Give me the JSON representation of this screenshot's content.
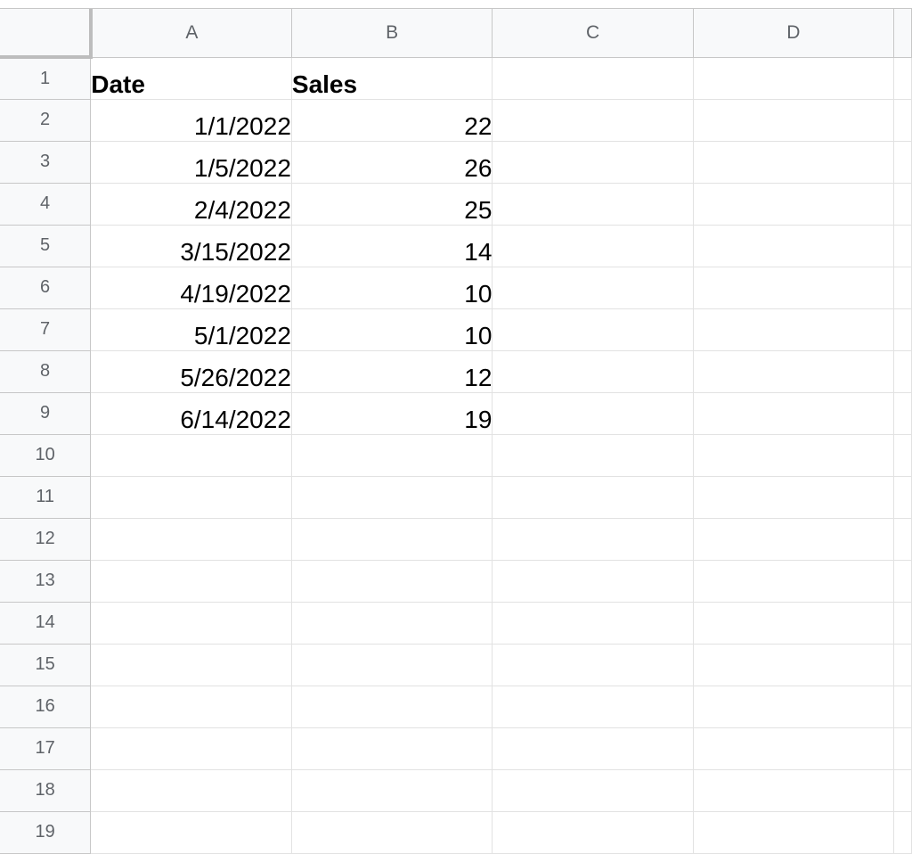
{
  "columns": [
    "A",
    "B",
    "C",
    "D"
  ],
  "rows": [
    {
      "n": "1",
      "a": "Date",
      "b": "Sales"
    },
    {
      "n": "2",
      "a": "1/1/2022",
      "b": "22"
    },
    {
      "n": "3",
      "a": "1/5/2022",
      "b": "26"
    },
    {
      "n": "4",
      "a": "2/4/2022",
      "b": "25"
    },
    {
      "n": "5",
      "a": "3/15/2022",
      "b": "14"
    },
    {
      "n": "6",
      "a": "4/19/2022",
      "b": "10"
    },
    {
      "n": "7",
      "a": "5/1/2022",
      "b": "10"
    },
    {
      "n": "8",
      "a": "5/26/2022",
      "b": "12"
    },
    {
      "n": "9",
      "a": "6/14/2022",
      "b": "19"
    },
    {
      "n": "10",
      "a": "",
      "b": ""
    },
    {
      "n": "11",
      "a": "",
      "b": ""
    },
    {
      "n": "12",
      "a": "",
      "b": ""
    },
    {
      "n": "13",
      "a": "",
      "b": ""
    },
    {
      "n": "14",
      "a": "",
      "b": ""
    },
    {
      "n": "15",
      "a": "",
      "b": ""
    },
    {
      "n": "16",
      "a": "",
      "b": ""
    },
    {
      "n": "17",
      "a": "",
      "b": ""
    },
    {
      "n": "18",
      "a": "",
      "b": ""
    },
    {
      "n": "19",
      "a": "",
      "b": ""
    }
  ]
}
